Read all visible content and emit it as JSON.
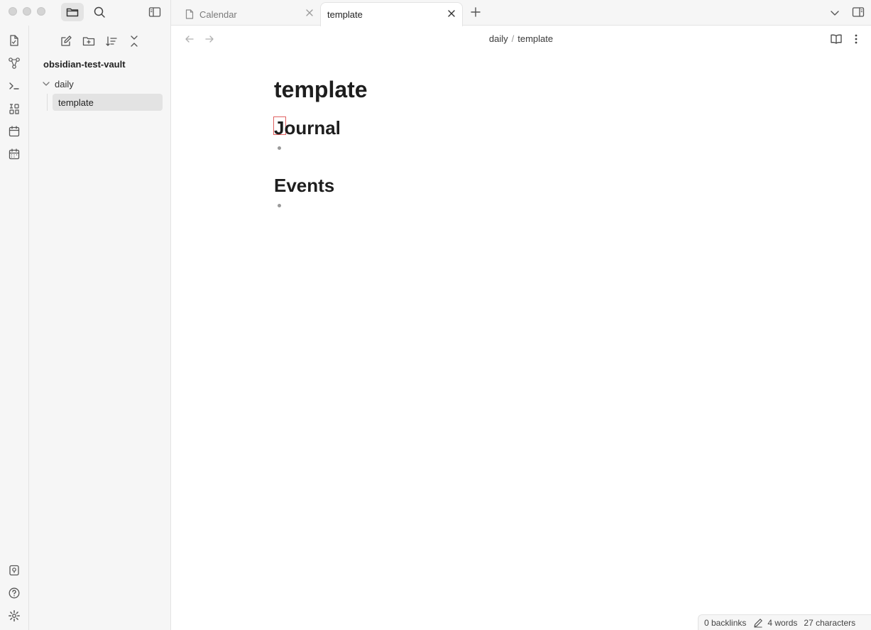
{
  "tabs": [
    {
      "label": "Calendar",
      "active": false
    },
    {
      "label": "template",
      "active": true
    }
  ],
  "sidebar": {
    "vault_name": "obsidian-test-vault",
    "folder": "daily",
    "file": "template"
  },
  "breadcrumb": {
    "folder": "daily",
    "separator": "/",
    "file": "template"
  },
  "note": {
    "title": "template",
    "sections": [
      {
        "heading": "Journal"
      },
      {
        "heading": "Events"
      }
    ]
  },
  "status": {
    "backlinks": "0 backlinks",
    "words": "4 words",
    "characters": "27 characters"
  },
  "icons": {
    "ribbon_top": [
      "files-icon",
      "graph-icon",
      "terminal-icon",
      "command-palette-icon",
      "calendar-icon",
      "daily-note-icon"
    ],
    "ribbon_bottom": [
      "vault-switch-icon",
      "help-icon",
      "settings-icon"
    ]
  }
}
